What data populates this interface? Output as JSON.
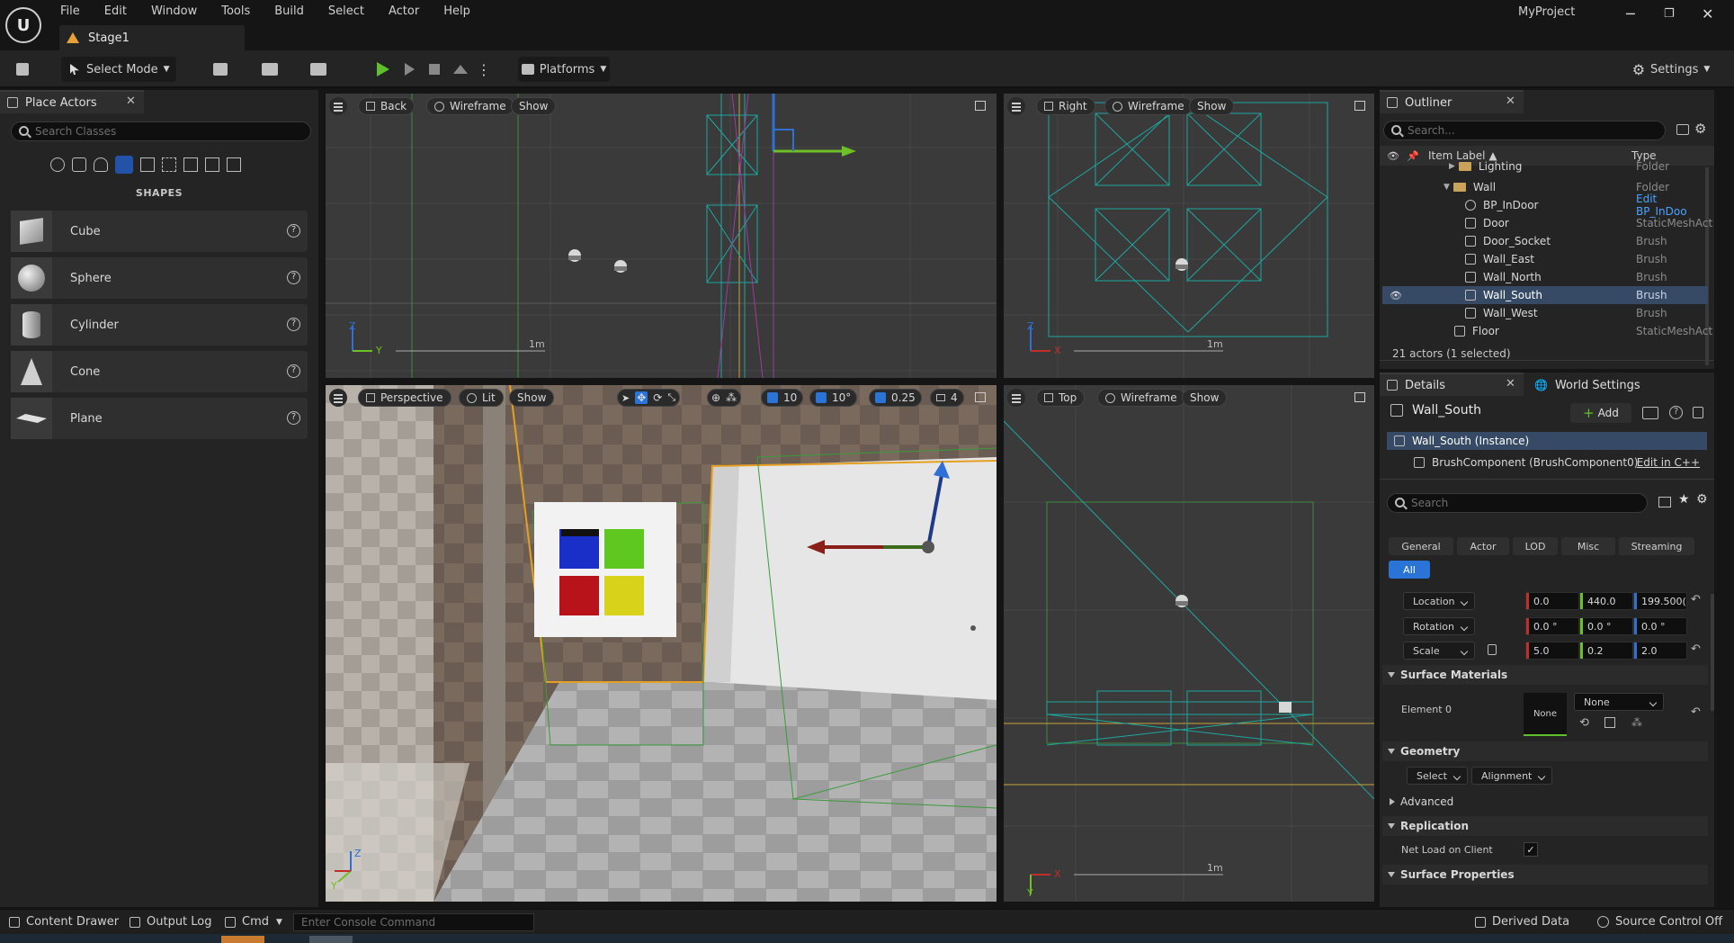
{
  "menu": [
    "File",
    "Edit",
    "Window",
    "Tools",
    "Build",
    "Select",
    "Actor",
    "Help"
  ],
  "document_tab": "Stage1",
  "project_name": "MyProject",
  "toolbar": {
    "select_mode": "Select Mode",
    "platforms": "Platforms",
    "settings": "Settings"
  },
  "place_actors": {
    "tab": "Place Actors",
    "search_placeholder": "Search Classes",
    "section": "SHAPES",
    "items": [
      "Cube",
      "Sphere",
      "Cylinder",
      "Cone",
      "Plane"
    ]
  },
  "viewports": {
    "back": {
      "view": "Back",
      "mode": "Wireframe",
      "show": "Show",
      "scale": "1m",
      "axis_a": "Y",
      "axis_b": "Z"
    },
    "right": {
      "view": "Right",
      "mode": "Wireframe",
      "show": "Show",
      "scale": "1m",
      "axis_a": "X",
      "axis_b": "Z"
    },
    "perspective": {
      "view": "Perspective",
      "mode": "Lit",
      "show": "Show",
      "grid": "10",
      "angle": "10°",
      "scale_snap": "0.25",
      "camera_speed": "4",
      "axis_a": "Y",
      "axis_b": "Z"
    },
    "top": {
      "view": "Top",
      "mode": "Wireframe",
      "show": "Show",
      "scale": "1m",
      "axis_a": "X",
      "axis_b": "Y"
    }
  },
  "outliner": {
    "tab": "Outliner",
    "search_placeholder": "Search...",
    "col_label": "Item Label ▲",
    "col_type": "Type",
    "rows": [
      {
        "label": "Lighting",
        "type": "Folder"
      },
      {
        "label": "Wall",
        "type": "Folder"
      },
      {
        "label": "BP_InDoor",
        "type": "Edit BP_InDoo"
      },
      {
        "label": "Door",
        "type": "StaticMeshAct"
      },
      {
        "label": "Door_Socket",
        "type": "Brush"
      },
      {
        "label": "Wall_East",
        "type": "Brush"
      },
      {
        "label": "Wall_North",
        "type": "Brush"
      },
      {
        "label": "Wall_South",
        "type": "Brush"
      },
      {
        "label": "Wall_West",
        "type": "Brush"
      },
      {
        "label": "Floor",
        "type": "StaticMeshAct"
      }
    ],
    "footer": "21 actors (1 selected)"
  },
  "details": {
    "tab": "Details",
    "tab2": "World Settings",
    "actor_name": "Wall_South",
    "add": "Add",
    "instance": "Wall_South (Instance)",
    "component": "BrushComponent (BrushComponent0)",
    "edit_cpp": "Edit in C++",
    "search_placeholder": "Search",
    "filters": [
      "General",
      "Actor",
      "LOD",
      "Misc",
      "Streaming",
      "All"
    ],
    "location_label": "Location",
    "rotation_label": "Rotation",
    "scale_label": "Scale",
    "location": [
      "0.0",
      "440.0",
      "199.500("
    ],
    "rotation": [
      "0.0 °",
      "0.0 °",
      "0.0 °"
    ],
    "scale": [
      "5.0",
      "0.2",
      "2.0"
    ],
    "surface_materials": "Surface Materials",
    "element0": "Element 0",
    "material_thumb": "None",
    "material_value": "None",
    "geometry": "Geometry",
    "geo_select": "Select",
    "geo_alignment": "Alignment",
    "advanced": "Advanced",
    "replication": "Replication",
    "net_load": "Net Load on Client",
    "surface_properties": "Surface Properties"
  },
  "statusbar": {
    "content_drawer": "Content Drawer",
    "output_log": "Output Log",
    "cmd": "Cmd",
    "console_placeholder": "Enter Console Command",
    "derived_data": "Derived Data",
    "source_control": "Source Control Off"
  },
  "colors": {
    "accent": "#2a74d8",
    "selection": "#364a66",
    "gizmo_x": "#c0302a",
    "gizmo_y": "#6fbf26",
    "gizmo_z": "#2f6fd6"
  }
}
